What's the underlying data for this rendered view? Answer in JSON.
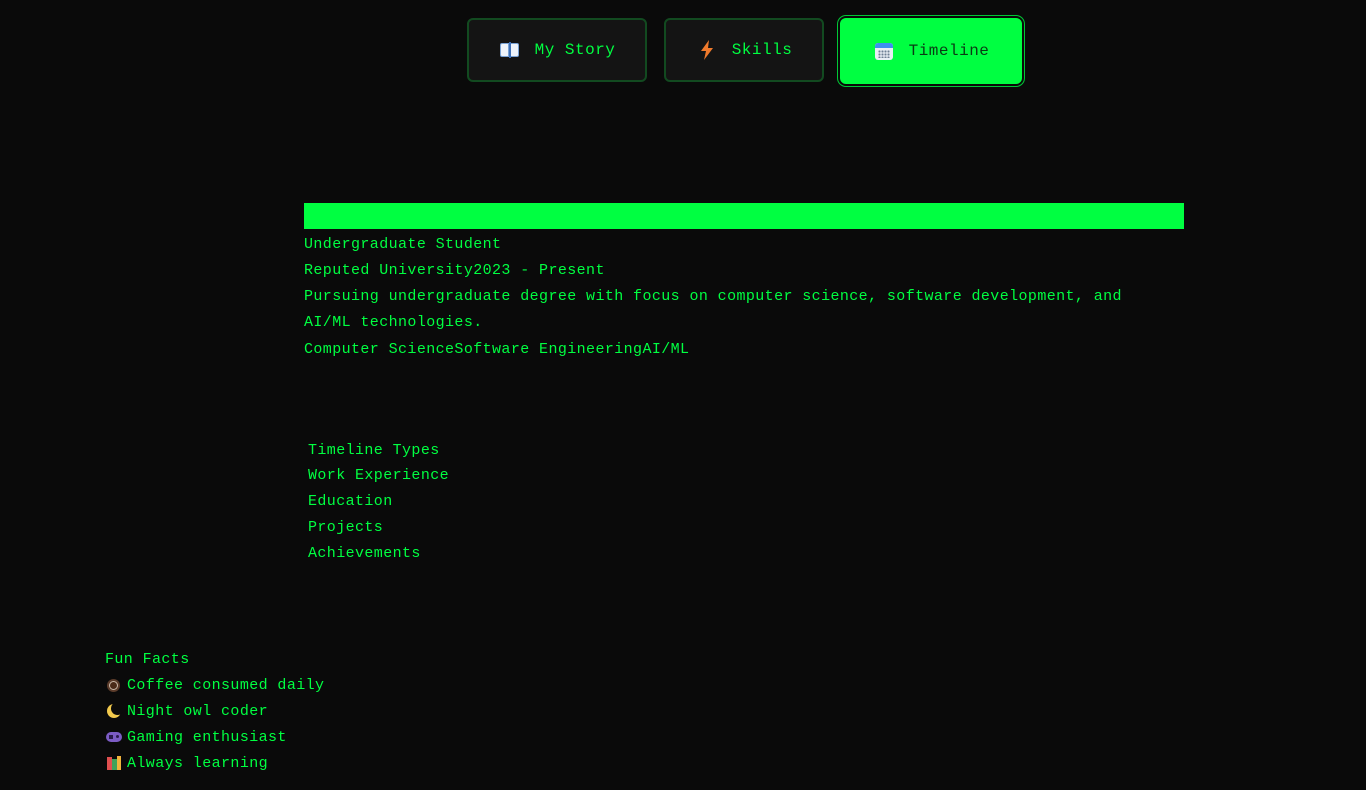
{
  "tabs": [
    {
      "label": "My Story",
      "icon": "book-icon",
      "active": false
    },
    {
      "label": "Skills",
      "icon": "lightning-icon",
      "active": false
    },
    {
      "label": "Timeline",
      "icon": "calendar-icon",
      "active": true
    }
  ],
  "timeline_entry": {
    "role": "Undergraduate Student",
    "organization_period": "Reputed University2023 - Present",
    "description": "Pursuing undergraduate degree with focus on computer science, software development, and AI/ML technologies.",
    "tags": "Computer ScienceSoftware EngineeringAI/ML"
  },
  "timeline_types": {
    "heading": "Timeline Types",
    "items": [
      "Work Experience",
      "Education",
      "Projects",
      "Achievements"
    ]
  },
  "fun_facts": {
    "heading": "Fun Facts",
    "items": [
      {
        "icon": "coffee-icon",
        "text": "Coffee consumed daily"
      },
      {
        "icon": "moon-icon",
        "text": "Night owl coder"
      },
      {
        "icon": "gamepad-icon",
        "text": "Gaming enthusiast"
      },
      {
        "icon": "books-icon",
        "text": "Always learning"
      }
    ]
  },
  "colors": {
    "accent": "#00ff41",
    "background": "#0a0a0a",
    "tab_border": "#124a20"
  }
}
